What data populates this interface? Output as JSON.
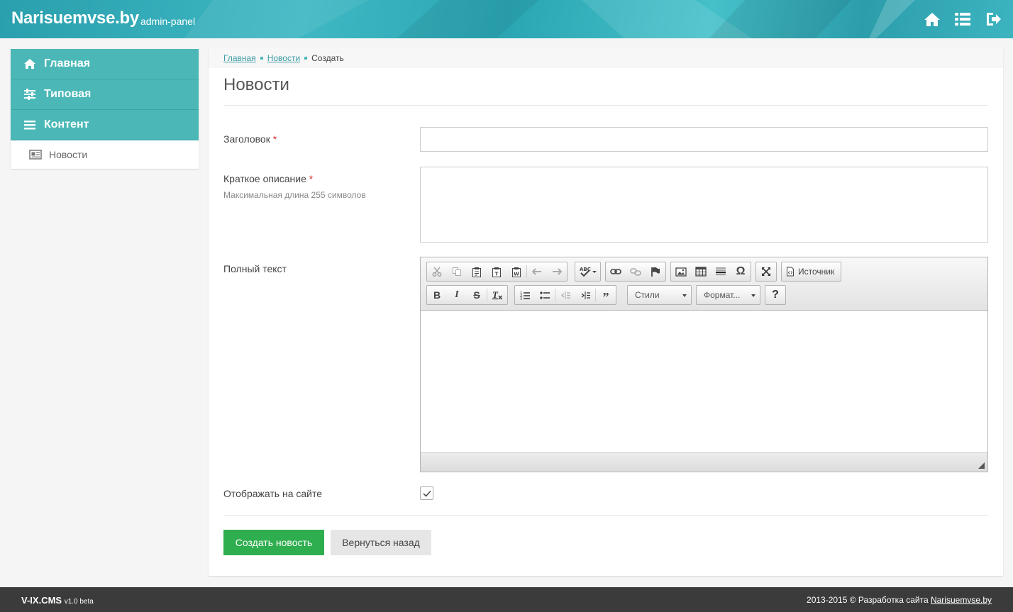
{
  "header": {
    "brand": "Narisuemvse.by",
    "subtitle": "admin-panel",
    "icons": [
      "home-icon",
      "list-icon",
      "logout-icon"
    ]
  },
  "sidebar": {
    "items": [
      {
        "label": "Главная",
        "icon": "home-icon"
      },
      {
        "label": "Типовая",
        "icon": "sliders-icon"
      },
      {
        "label": "Контент",
        "icon": "bars-icon"
      }
    ],
    "subitems": [
      {
        "label": "Новости",
        "icon": "newspaper-icon"
      }
    ],
    "accent": "#4bb8b7"
  },
  "breadcrumb": {
    "items": [
      "Главная",
      "Новости"
    ],
    "current": "Создать"
  },
  "page": {
    "title": "Новости"
  },
  "form": {
    "title_label": "Заголовок",
    "title_value": "",
    "summary_label": "Краткое описание",
    "summary_hint": "Максимальная длина 255 символов",
    "summary_value": "",
    "fulltext_label": "Полный текст",
    "required_mark": "*",
    "show_label": "Отображать на сайте",
    "show_checked": true
  },
  "editor": {
    "source_label": "Источник",
    "styles_label": "Стили",
    "format_label": "Формат...",
    "help_label": "?",
    "toolbar_icons": [
      "cut-icon",
      "copy-icon",
      "paste-icon",
      "paste-text-icon",
      "paste-word-icon",
      "undo-icon",
      "redo-icon",
      "spellcheck-icon",
      "link-icon",
      "unlink-icon",
      "anchor-icon",
      "image-icon",
      "table-icon",
      "hr-icon",
      "special-char-icon",
      "maximize-icon",
      "source-icon",
      "bold-icon",
      "italic-icon",
      "strike-icon",
      "remove-format-icon",
      "numbered-list-icon",
      "bulleted-list-icon",
      "outdent-icon",
      "indent-icon",
      "blockquote-icon",
      "help-icon"
    ]
  },
  "buttons": {
    "submit": "Создать новость",
    "back": "Вернуться назад",
    "submit_color": "#2fae4f"
  },
  "footer": {
    "product": "V-IX.CMS",
    "version": "v1.0 beta",
    "copyright": "2013-2015 © Разработка сайта",
    "link": "Narisuemvse.by"
  }
}
